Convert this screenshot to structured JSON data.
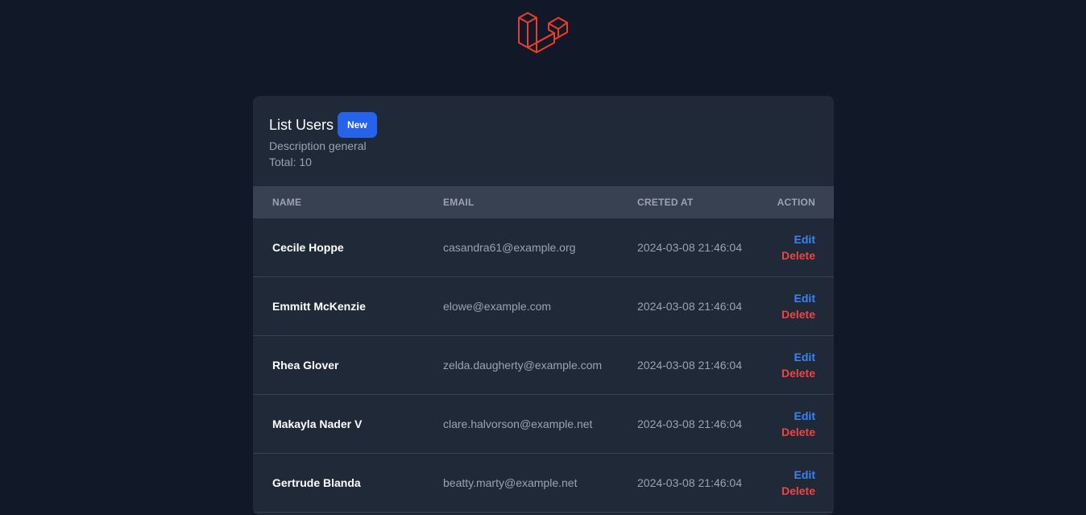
{
  "brand": {
    "logo_icon": "laravel-logo-icon",
    "accent": "#ef3b2d"
  },
  "header": {
    "title": "List Users",
    "new_label": "New",
    "description": "Description general",
    "total": "Total: 10"
  },
  "table": {
    "columns": {
      "name": "NAME",
      "email": "EMAIL",
      "created": "CRETED AT",
      "action": "ACTION"
    },
    "rows": [
      {
        "name": "Cecile Hoppe",
        "email": "casandra61@example.org",
        "created": "2024-03-08 21:46:04",
        "edit": "Edit",
        "delete": "Delete"
      },
      {
        "name": "Emmitt McKenzie",
        "email": "elowe@example.com",
        "created": "2024-03-08 21:46:04",
        "edit": "Edit",
        "delete": "Delete"
      },
      {
        "name": "Rhea Glover",
        "email": "zelda.daugherty@example.com",
        "created": "2024-03-08 21:46:04",
        "edit": "Edit",
        "delete": "Delete"
      },
      {
        "name": "Makayla Nader V",
        "email": "clare.halvorson@example.net",
        "created": "2024-03-08 21:46:04",
        "edit": "Edit",
        "delete": "Delete"
      },
      {
        "name": "Gertrude Blanda",
        "email": "beatty.marty@example.net",
        "created": "2024-03-08 21:46:04",
        "edit": "Edit",
        "delete": "Delete"
      }
    ]
  }
}
